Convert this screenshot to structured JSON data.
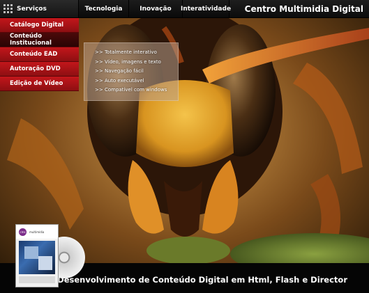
{
  "header": {
    "menu_title": "Serviços",
    "nav": [
      {
        "label": "Tecnologia"
      },
      {
        "label": "Inovação"
      },
      {
        "label": "Interatividade"
      }
    ],
    "site_title": "Centro Multimidia Digital"
  },
  "sidebar": {
    "items": [
      {
        "label": "Catálogo Digital",
        "active": false
      },
      {
        "label": "Conteúdo Institucional",
        "active": true
      },
      {
        "label": "Conteúdo EAD",
        "active": false
      },
      {
        "label": "Autoração DVD",
        "active": false
      },
      {
        "label": "Edição de Vídeo",
        "active": false
      }
    ]
  },
  "features": [
    ">> Totalmente interativo",
    ">> Vídeo, imagens e texto",
    ">> Navegação fácil",
    ">> Auto executável",
    ">> Compatível com windows"
  ],
  "footer": {
    "tagline": "Desenvolvimento de Conteúdo Digital em Html, Flash e Director"
  },
  "colors": {
    "menu_red": "#c3161b",
    "menu_active": "#4b0a0a",
    "bar_black": "#050505"
  }
}
